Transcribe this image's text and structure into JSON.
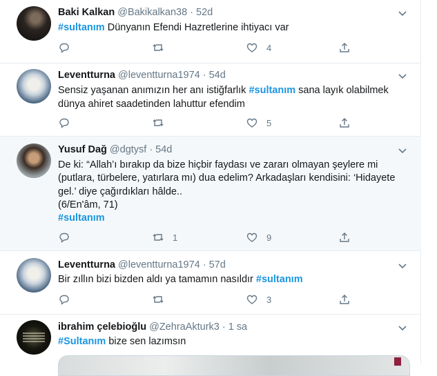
{
  "tweets": [
    {
      "name": "Baki Kalkan",
      "handle": "@Bakikalkan38",
      "dot": "·",
      "time": "52d",
      "text": [
        {
          "tag": "#sultanım"
        },
        {
          "t": " Dünyanın Efendi Hazretlerine ihtiyacı var"
        }
      ],
      "reply_count": "",
      "retweet_count": "",
      "like_count": "4"
    },
    {
      "name": "Leventturna",
      "handle": "@leventturna1974",
      "dot": "·",
      "time": "54d",
      "text": [
        {
          "t": "Sensiz yaşanan anımızın her anı istiğfarlık  "
        },
        {
          "tag": "#sultanım"
        },
        {
          "t": " sana layık olabilmek dünya ahiret saadetinden lahuttur efendim"
        }
      ],
      "reply_count": "",
      "retweet_count": "",
      "like_count": "5"
    },
    {
      "name": "Yusuf Dağ",
      "handle": "@dgtysf",
      "dot": "·",
      "time": "54d",
      "text": [
        {
          "t": "De ki: “Allah’ı bırakıp da bize hiçbir faydası ve zararı olmayan şeylere mi (putlara, türbelere, yatırlara mı) dua edelim? Arkadaşları kendisini: ‘Hidayete gel.’ diye çağırdıkları hâlde.."
        },
        {
          "br": true
        },
        {
          "t": "(6/En'âm, 71)"
        },
        {
          "br": true
        },
        {
          "tag": "#sultanım"
        }
      ],
      "reply_count": "",
      "retweet_count": "1",
      "like_count": "9"
    },
    {
      "name": "Leventturna",
      "handle": "@leventturna1974",
      "dot": "·",
      "time": "57d",
      "text": [
        {
          "t": "Bir zıllın bizi bizden aldı  ya tamamın nasıldır "
        },
        {
          "tag": "#sultanım"
        }
      ],
      "reply_count": "",
      "retweet_count": "",
      "like_count": "3"
    },
    {
      "name": "ibrahim çelebioğlu",
      "handle": "@ZehraAkturk3",
      "dot": "·",
      "time": "1 sa",
      "text": [
        {
          "tag": "#Sultanım"
        },
        {
          "t": " bize sen lazımsın"
        }
      ]
    }
  ],
  "icons": {
    "reply": "reply-icon",
    "retweet": "retweet-icon",
    "like": "heart-icon",
    "share": "share-icon",
    "more": "chevron-down-icon"
  },
  "colors": {
    "hashtag": "#1b95e0",
    "muted": "#657786",
    "highlight_bg": "#f5f8fa",
    "divider": "#e6ecf0"
  }
}
